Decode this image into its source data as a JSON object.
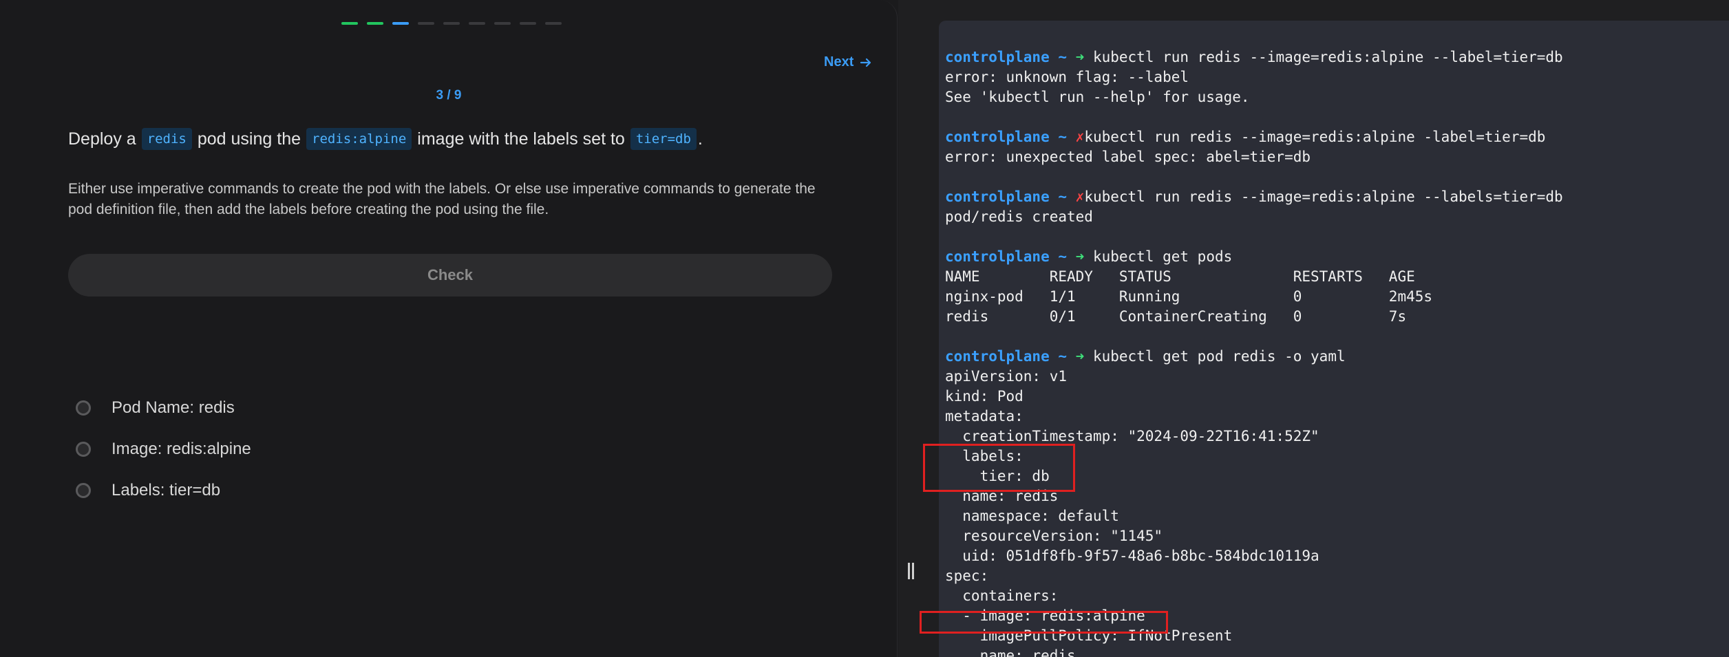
{
  "progress": {
    "total": 9,
    "done": 2,
    "current_index": 2
  },
  "nav": {
    "next_label": "Next"
  },
  "counter": "3 / 9",
  "question": {
    "parts": [
      {
        "type": "text",
        "value": "Deploy a"
      },
      {
        "type": "code",
        "value": "redis"
      },
      {
        "type": "text",
        "value": "pod using the"
      },
      {
        "type": "code",
        "value": "redis:alpine"
      },
      {
        "type": "text",
        "value": "image with the labels set to"
      },
      {
        "type": "code",
        "value": "tier=db"
      },
      {
        "type": "text",
        "value": "."
      }
    ]
  },
  "description": "Either use imperative commands to create the pod with the labels. Or else use imperative commands to generate the pod definition file, then add the labels before creating the pod using the file.",
  "check_button": "Check",
  "criteria": [
    "Pod Name: redis",
    "Image: redis:alpine",
    "Labels: tier=db"
  ],
  "terminal": {
    "prompt": "controlplane ~",
    "ok_arrow": "➜",
    "err_mark": "✗",
    "lines": [
      {
        "kind": "cmd",
        "status": "ok",
        "text": " kubectl run redis --image=redis:alpine --label=tier=db"
      },
      {
        "kind": "out",
        "text": "error: unknown flag: --label"
      },
      {
        "kind": "out",
        "text": "See 'kubectl run --help' for usage."
      },
      {
        "kind": "out",
        "text": ""
      },
      {
        "kind": "cmd",
        "status": "err",
        "text": "kubectl run redis --image=redis:alpine -label=tier=db"
      },
      {
        "kind": "out",
        "text": "error: unexpected label spec: abel=tier=db"
      },
      {
        "kind": "out",
        "text": ""
      },
      {
        "kind": "cmd",
        "status": "err",
        "text": "kubectl run redis --image=redis:alpine --labels=tier=db"
      },
      {
        "kind": "out",
        "text": "pod/redis created"
      },
      {
        "kind": "out",
        "text": ""
      },
      {
        "kind": "cmd",
        "status": "ok",
        "text": " kubectl get pods"
      },
      {
        "kind": "out",
        "text": "NAME        READY   STATUS              RESTARTS   AGE"
      },
      {
        "kind": "out",
        "text": "nginx-pod   1/1     Running             0          2m45s"
      },
      {
        "kind": "out",
        "text": "redis       0/1     ContainerCreating   0          7s"
      },
      {
        "kind": "out",
        "text": ""
      },
      {
        "kind": "cmd",
        "status": "ok",
        "text": " kubectl get pod redis -o yaml"
      },
      {
        "kind": "out",
        "text": "apiVersion: v1"
      },
      {
        "kind": "out",
        "text": "kind: Pod"
      },
      {
        "kind": "out",
        "text": "metadata:"
      },
      {
        "kind": "out",
        "text": "  creationTimestamp: \"2024-09-22T16:41:52Z\""
      },
      {
        "kind": "out",
        "text": "  labels:"
      },
      {
        "kind": "out",
        "text": "    tier: db"
      },
      {
        "kind": "out",
        "text": "  name: redis"
      },
      {
        "kind": "out",
        "text": "  namespace: default"
      },
      {
        "kind": "out",
        "text": "  resourceVersion: \"1145\""
      },
      {
        "kind": "out",
        "text": "  uid: 051df8fb-9f57-48a6-b8bc-584bdc10119a"
      },
      {
        "kind": "out",
        "text": "spec:"
      },
      {
        "kind": "out",
        "text": "  containers:"
      },
      {
        "kind": "out",
        "text": "  - image: redis:alpine"
      },
      {
        "kind": "out",
        "text": "    imagePullPolicy: IfNotPresent"
      },
      {
        "kind": "out",
        "text": "    name: redis"
      }
    ]
  },
  "colors": {
    "accent_blue": "#3b9cf5",
    "done_green": "#22c55e",
    "prompt_blue": "#3ba0ff",
    "ok_green": "#3ee07a",
    "err_red": "#ff4444",
    "highlight_red": "#e02020"
  }
}
